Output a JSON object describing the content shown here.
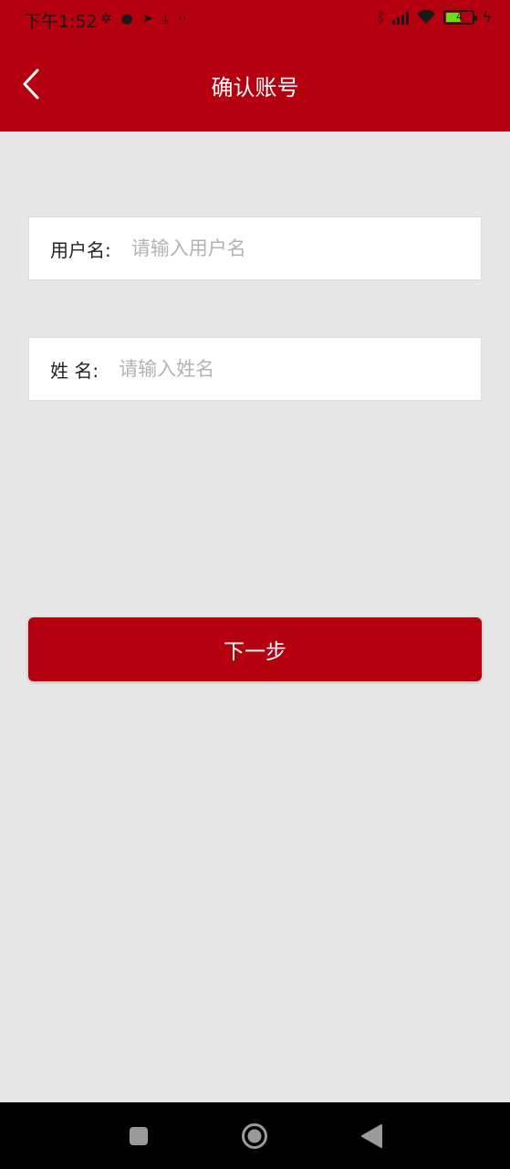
{
  "status_bar": {
    "time": "下午1:52",
    "battery_level": "4"
  },
  "header": {
    "title": "确认账号",
    "accent_color": "#b4000f"
  },
  "form": {
    "username": {
      "label": "用户名:",
      "placeholder": "请输入用户名",
      "value": ""
    },
    "name": {
      "label": "姓 名:",
      "placeholder": "请输入姓名",
      "value": ""
    }
  },
  "actions": {
    "next_label": "下一步"
  },
  "icons": {
    "back": "chevron-left-icon",
    "recent": "square-icon",
    "home": "circle-icon",
    "sys_back": "triangle-back-icon"
  }
}
